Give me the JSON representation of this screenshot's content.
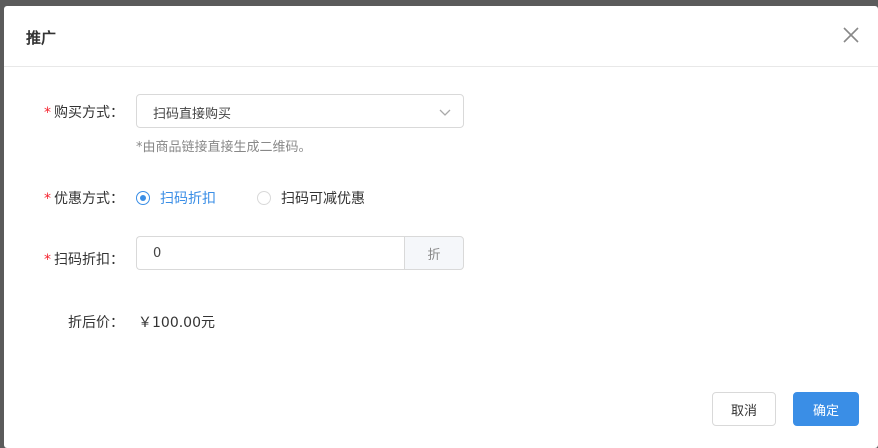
{
  "dialog": {
    "title": "推广"
  },
  "form": {
    "purchase_method": {
      "required_mark": "*",
      "label": "购买方式：",
      "selected": "扫码直接购买",
      "hint": "*由商品链接直接生成二维码。"
    },
    "discount_method": {
      "required_mark": "*",
      "label": "优惠方式：",
      "options": [
        {
          "label": "扫码折扣",
          "checked": true
        },
        {
          "label": "扫码可减优惠",
          "checked": false
        }
      ]
    },
    "scan_discount": {
      "required_mark": "*",
      "label": "扫码折扣：",
      "value": "0",
      "unit": "折"
    },
    "discounted_price": {
      "label": "折后价：",
      "value": "￥100.00元"
    }
  },
  "footer": {
    "cancel_label": "取消",
    "ok_label": "确定"
  },
  "colors": {
    "accent": "#3a8ee6",
    "required": "#f5222d"
  }
}
